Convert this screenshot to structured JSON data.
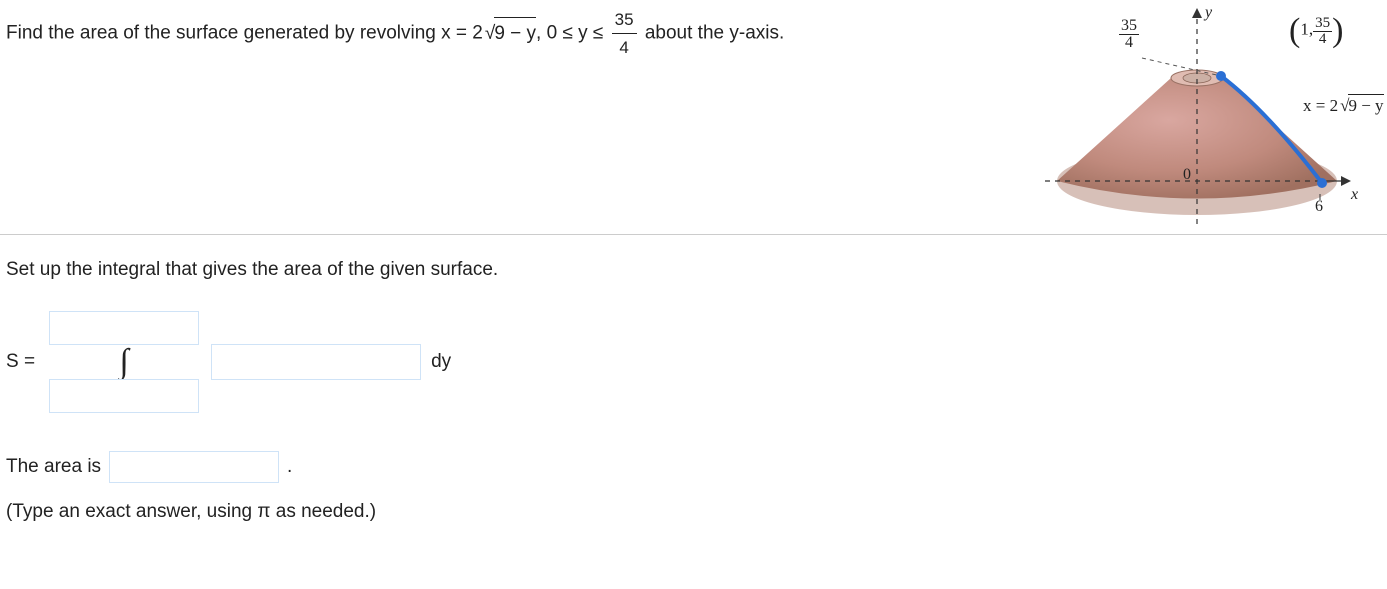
{
  "problem": {
    "prefix": "Find the area of the surface generated by revolving x = 2",
    "sqrt_expr": "9 − y",
    "range_prefix": ", 0 ≤ y ≤ ",
    "frac_num": "35",
    "frac_den": "4",
    "suffix": " about the y-axis."
  },
  "figure": {
    "y_axis_label": "y",
    "x_axis_label": "x",
    "top_left_frac_num": "35",
    "top_left_frac_den": "4",
    "point_label_prefix": "1,",
    "point_frac_num": "35",
    "point_frac_den": "4",
    "curve_label_prefix": "x = 2",
    "curve_sqrt_expr": "9 − y",
    "origin_label": "0",
    "x_tick": "6"
  },
  "setup_text": "Set up the integral that gives the area of the given surface.",
  "S_label": "S =",
  "dy_label": "dy",
  "area_label": "The area is",
  "period": ".",
  "hint": "(Type an exact answer, using π as needed.)"
}
